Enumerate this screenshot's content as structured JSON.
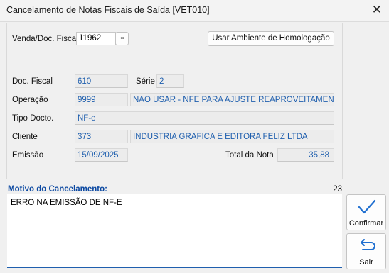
{
  "window": {
    "title": "Cancelamento de Notas Fiscais de Saída [VET010]",
    "close_glyph": "✕"
  },
  "header": {
    "venda_label": "Venda/Doc. Fiscal",
    "venda_value": "11962",
    "lookup_glyph": "•••",
    "homolog_button": "Usar Ambiente de Homologação"
  },
  "details": {
    "doc_fiscal_label": "Doc. Fiscal",
    "doc_fiscal_value": "610",
    "serie_label": "Série",
    "serie_value": "2",
    "operacao_label": "Operação",
    "operacao_code": "9999",
    "operacao_desc": "NAO USAR - NFE PARA AJUSTE REAPROVEITAMENTO",
    "tipo_label": "Tipo Docto.",
    "tipo_value": "NF-e",
    "cliente_label": "Cliente",
    "cliente_code": "373",
    "cliente_name": "INDUSTRIA GRAFICA E EDITORA FELIZ LTDA",
    "emissao_label": "Emissão",
    "emissao_value": "15/09/2025",
    "total_label": "Total da Nota",
    "total_value": "35,88"
  },
  "motivo": {
    "label": "Motivo do Cancelamento:",
    "count": "23",
    "text": "ERRO NA EMISSÃO DE NF-E"
  },
  "actions": {
    "confirmar": "Confirmar",
    "sair": "Sair"
  },
  "colors": {
    "value_text": "#1f5fae",
    "motivo_label": "#0b48a1",
    "accent": "#1f6fd0"
  },
  "icons": {
    "confirmar": "checkmark-icon",
    "sair": "return-arrow-icon",
    "close": "close-icon"
  }
}
